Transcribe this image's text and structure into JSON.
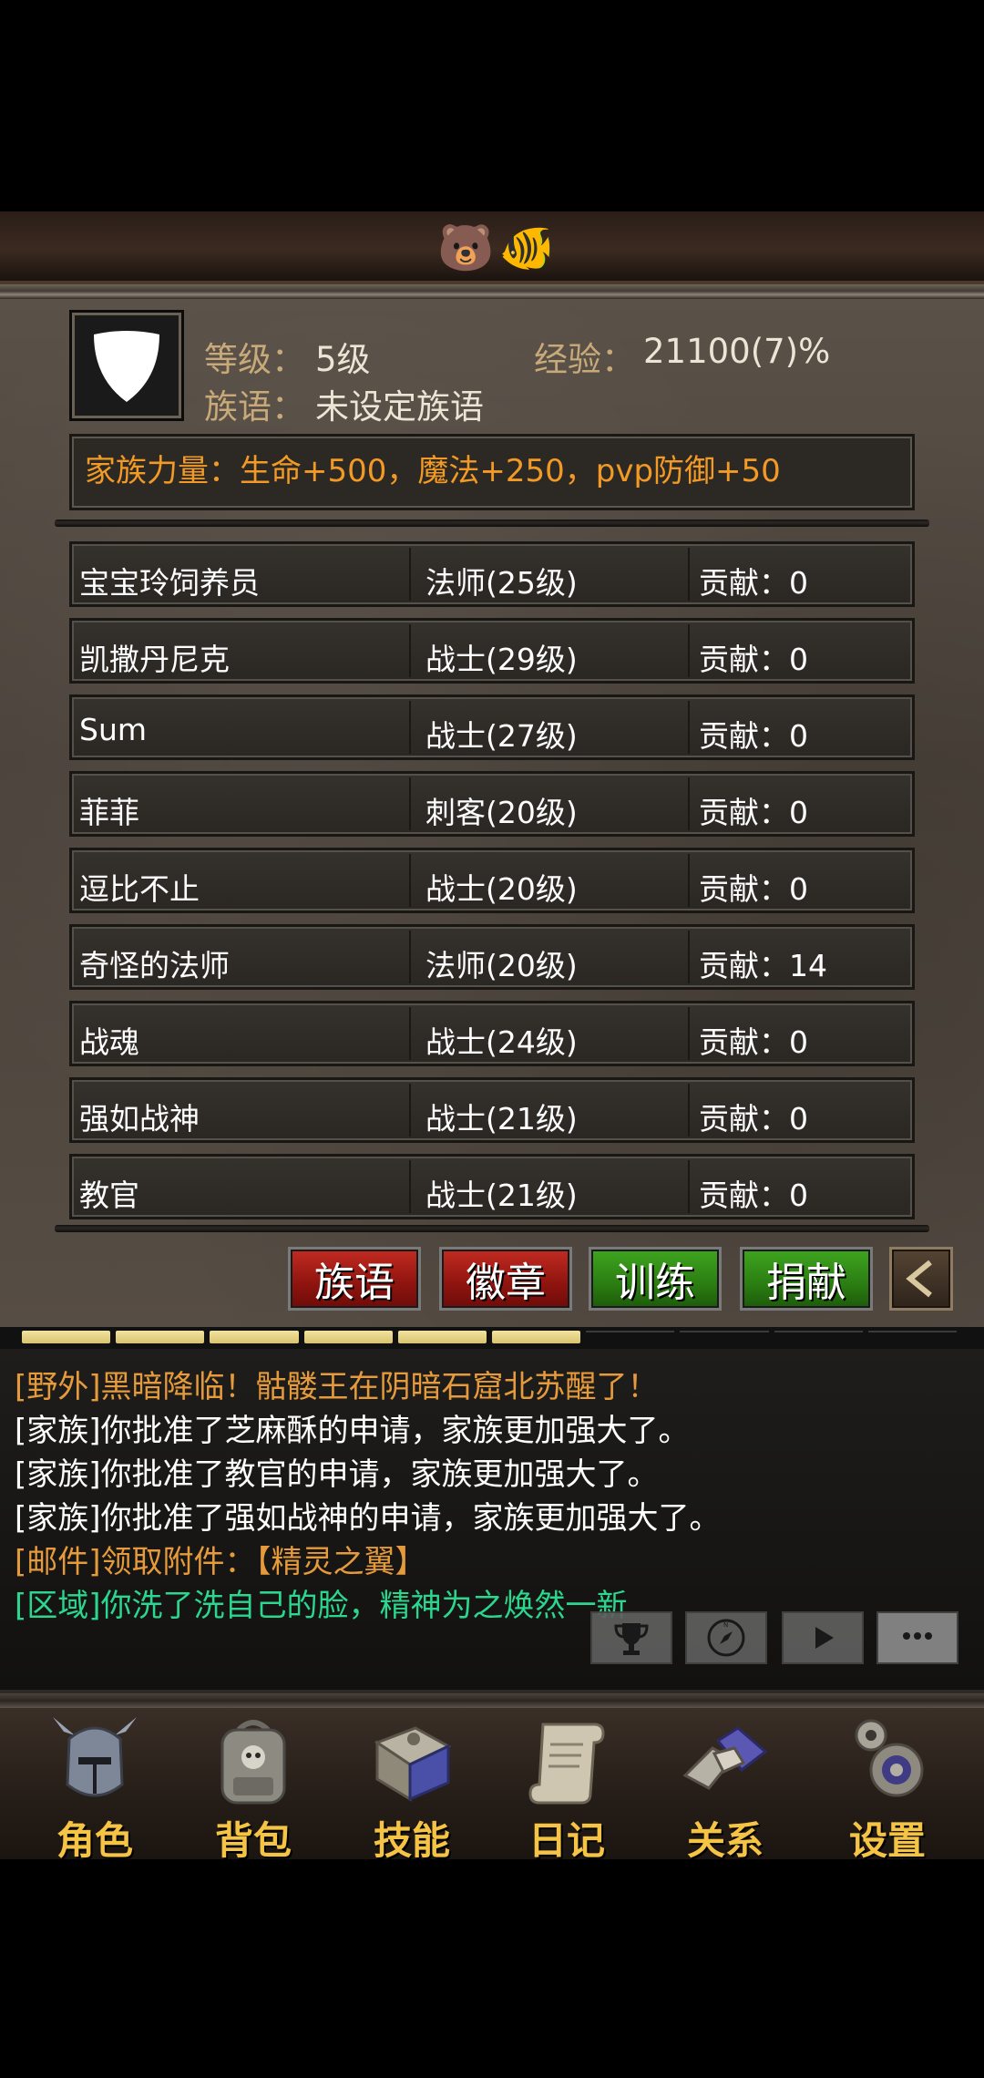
{
  "header": {
    "emojis": [
      "🐻",
      "🐠"
    ]
  },
  "family": {
    "level_label": "等级：",
    "level_value": "5级",
    "exp_label": "经验：",
    "exp_value": "21100(7)%",
    "motto_label": "族语：",
    "motto_value": "未设定族语",
    "power_text": "家族力量：生命+500，魔法+250，pvp防御+50"
  },
  "members": [
    {
      "name": "宝宝玲饲养员",
      "class": "法师(25级)",
      "contribution": "贡献：0"
    },
    {
      "name": "凯撒丹尼克",
      "class": "战士(29级)",
      "contribution": "贡献：0"
    },
    {
      "name": "Sum",
      "class": "战士(27级)",
      "contribution": "贡献：0"
    },
    {
      "name": "菲菲",
      "class": "刺客(20级)",
      "contribution": "贡献：0"
    },
    {
      "name": "逗比不止",
      "class": "战士(20级)",
      "contribution": "贡献：0"
    },
    {
      "name": "奇怪的法师",
      "class": "法师(20级)",
      "contribution": "贡献：14"
    },
    {
      "name": "战魂",
      "class": "战士(24级)",
      "contribution": "贡献：0"
    },
    {
      "name": "强如战神",
      "class": "战士(21级)",
      "contribution": "贡献：0"
    },
    {
      "name": "教官",
      "class": "战士(21级)",
      "contribution": "贡献：0"
    }
  ],
  "actions": {
    "motto": "族语",
    "badge": "徽章",
    "train": "训练",
    "donate": "捐献"
  },
  "progress": {
    "filled_segments": 6,
    "total_segments": 10
  },
  "chat": [
    {
      "text": "[野外]黑暗降临！骷髅王在阴暗石窟北苏醒了！",
      "color": "yellow"
    },
    {
      "text": "[家族]你批准了芝麻酥的申请，家族更加强大了。",
      "color": "white"
    },
    {
      "text": "[家族]你批准了教官的申请，家族更加强大了。",
      "color": "white"
    },
    {
      "text": "[家族]你批准了强如战神的申请，家族更加强大了。",
      "color": "white"
    },
    {
      "text": "[邮件]领取附件：【精灵之翼】",
      "color": "yellow"
    },
    {
      "text": "[区域]你洗了洗自己的脸，精神为之焕然一新",
      "color": "green"
    }
  ],
  "chat_buttons": [
    "trophy-icon",
    "compass-icon",
    "play-icon",
    "chat-bubble-icon"
  ],
  "nav": {
    "role": "角色",
    "bag": "背包",
    "skill": "技能",
    "diary": "日记",
    "relation": "关系",
    "settings": "设置"
  },
  "colors": {
    "gold_text": "#f6c445",
    "power_text": "#f29a25",
    "chat_yellow": "#e59a3b",
    "chat_green": "#2bd68e",
    "button_red": "#c22b21",
    "button_green": "#3ea51f"
  }
}
